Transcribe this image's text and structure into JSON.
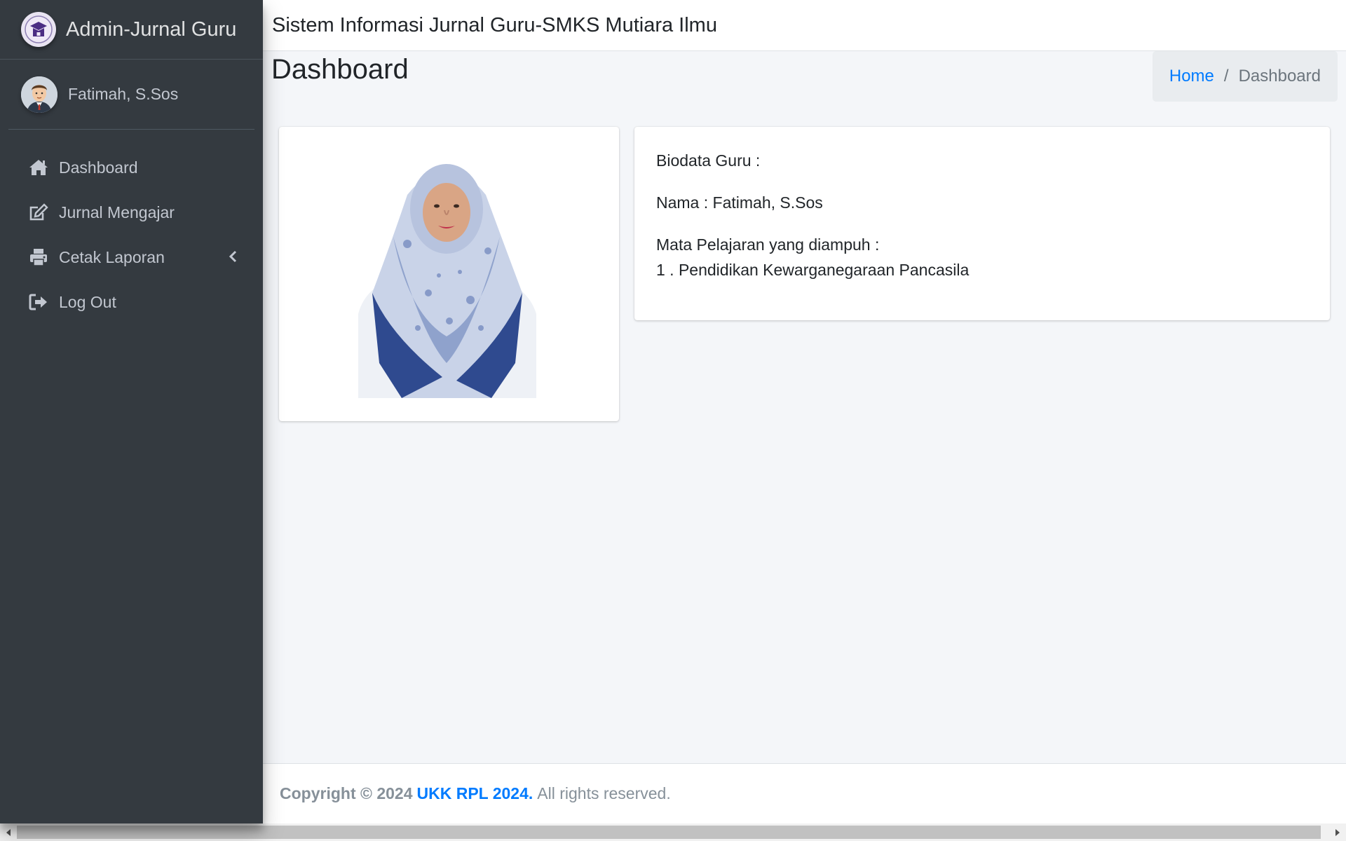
{
  "app": {
    "brand_name": "Admin-Jurnal Guru",
    "system_title": "Sistem Informasi Jurnal Guru-SMKS Mutiara Ilmu"
  },
  "user": {
    "name": "Fatimah, S.Sos"
  },
  "sidebar": {
    "items": [
      {
        "label": "Dashboard",
        "icon": "home-icon"
      },
      {
        "label": "Jurnal Mengajar",
        "icon": "edit-icon"
      },
      {
        "label": "Cetak Laporan",
        "icon": "printer-icon",
        "has_submenu": true
      },
      {
        "label": "Log Out",
        "icon": "sign-out-icon"
      }
    ]
  },
  "page": {
    "title": "Dashboard",
    "breadcrumb": {
      "home": "Home",
      "separator": "/",
      "current": "Dashboard"
    }
  },
  "biodata": {
    "heading": "Biodata Guru :",
    "name_line": "Nama : Fatimah, S.Sos",
    "subjects_heading": "Mata Pelajaran yang diampuh :",
    "subjects": [
      "1 . Pendidikan Kewarganegaraan Pancasila"
    ]
  },
  "footer": {
    "prefix": "Copyright © 2024",
    "link": "UKK RPL 2024.",
    "suffix": "All rights reserved."
  },
  "colors": {
    "sidebar_bg": "#343a40",
    "accent": "#007bff",
    "content_bg": "#f4f6f9"
  }
}
